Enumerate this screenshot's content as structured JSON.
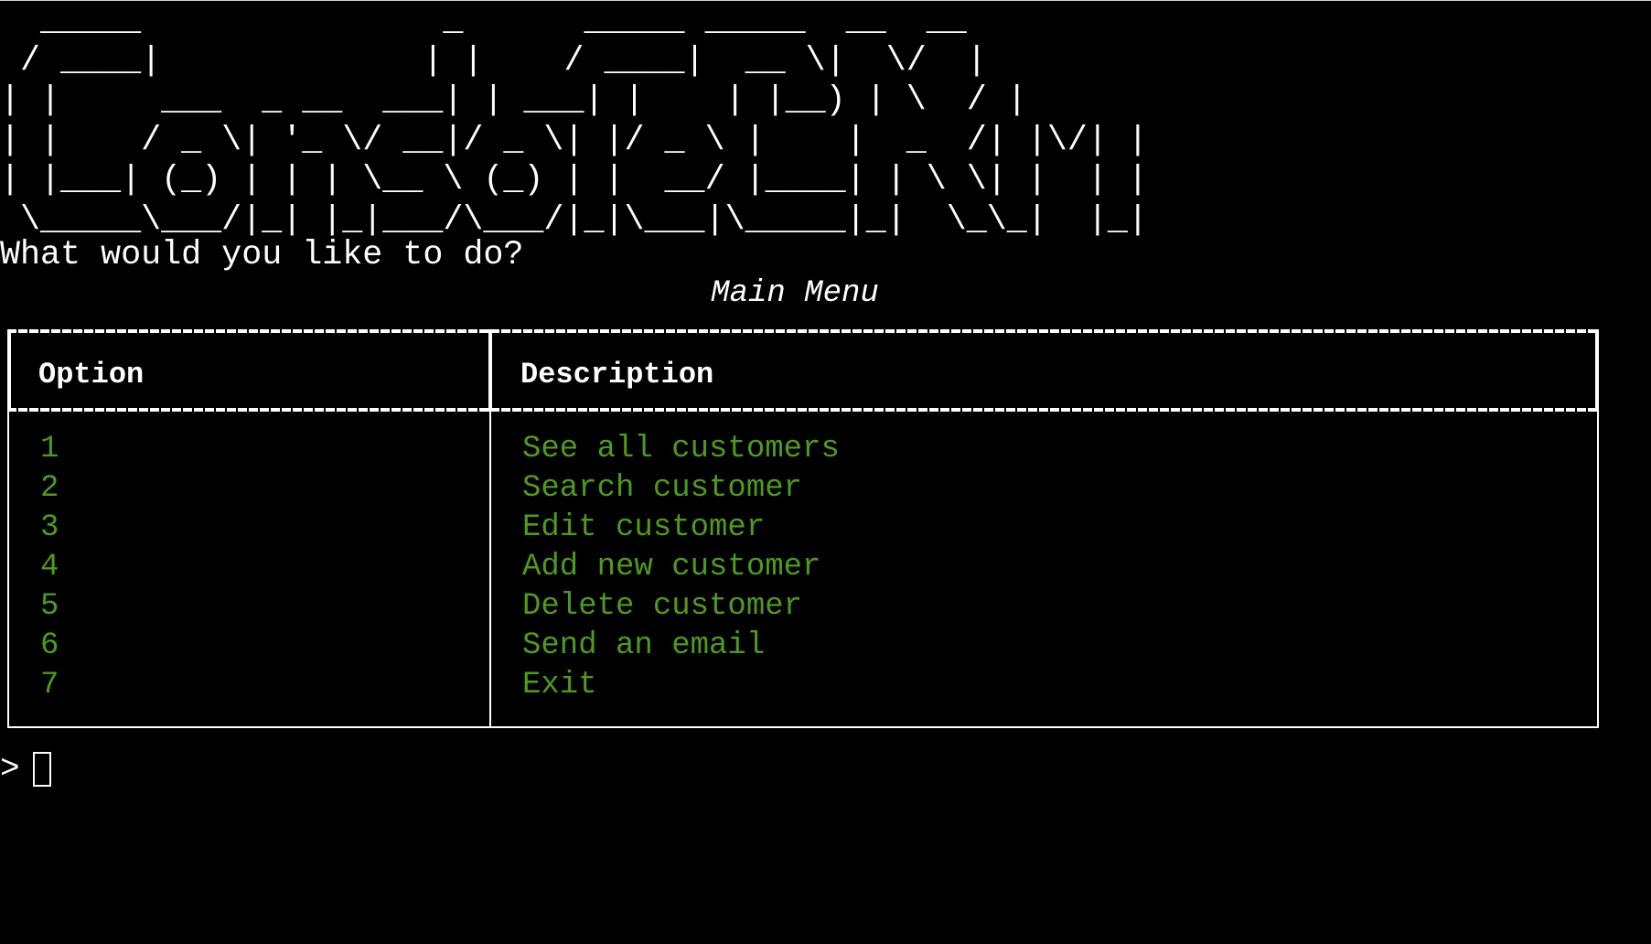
{
  "banner": {
    "text_lines": [
      "  _____               _      _____ _____  __  __",
      " / ____|             | |    / ____|  __ \\|  \\/  |",
      "| |     ___  _ __  ___| | ___| |    | |__) | \\  / |",
      "| |    / _ \\| '_ \\/ __|/ _ \\| |/ _ \\ |    |  _  /| |\\/| |",
      "| |___| (_) | | | \\__ \\ (_) | |  __/ |____| | \\ \\| |  | |",
      " \\_____\\___/|_| |_|___/\\___/|_|\\___|\\_____|_|  \\_\\_|  |_|"
    ]
  },
  "prompt": {
    "question": "What would you like to do?",
    "caret": ">"
  },
  "menu": {
    "title": "Main Menu",
    "columns": [
      "Option",
      "Description"
    ],
    "rows": [
      {
        "option": "1",
        "description": "See all customers"
      },
      {
        "option": "2",
        "description": "Search customer"
      },
      {
        "option": "3",
        "description": "Edit customer"
      },
      {
        "option": "4",
        "description": "Add new customer"
      },
      {
        "option": "5",
        "description": "Delete customer"
      },
      {
        "option": "6",
        "description": "Send an email"
      },
      {
        "option": "7",
        "description": "Exit"
      }
    ]
  },
  "colors": {
    "background": "#000000",
    "text": "#ffffff",
    "accent_purple": "#a052c8",
    "row_text_green": "#4e9a1e"
  }
}
